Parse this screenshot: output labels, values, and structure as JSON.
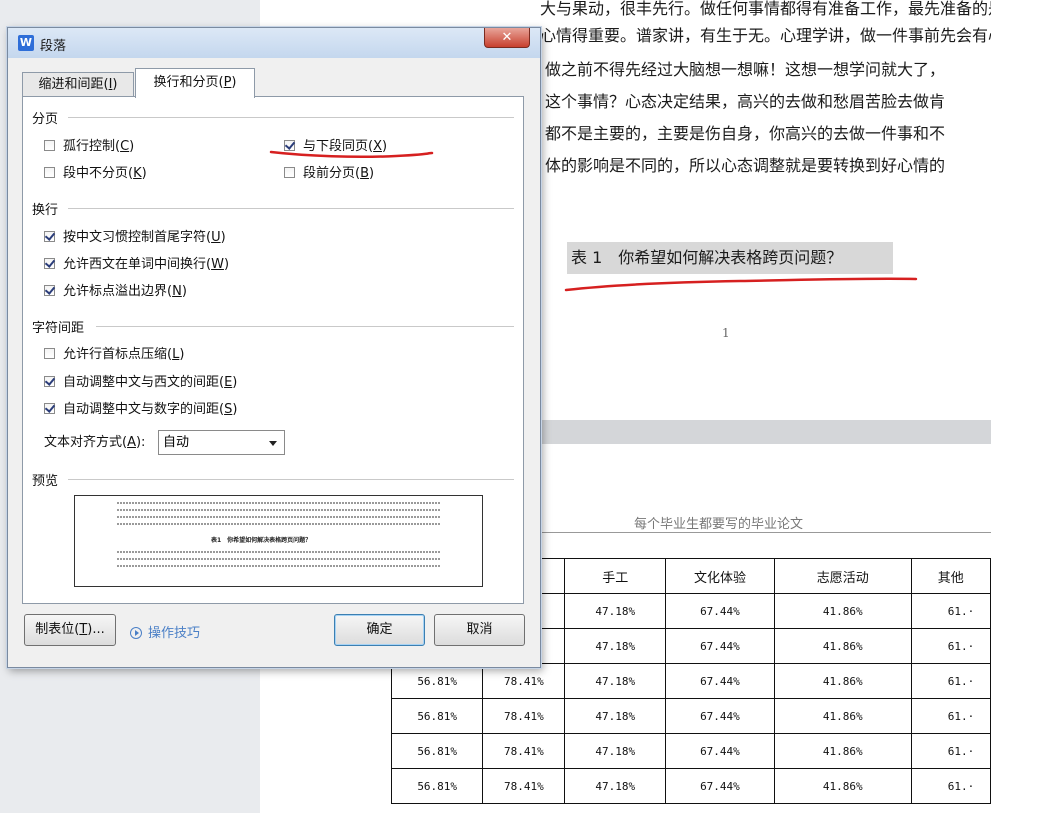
{
  "document": {
    "body_lines": [
      "大与果动，很丰先行。做任何事情都得有准备工作，最先准备的是情绪",
      "心情得重要。谱家讲，有生于无。心理学讲，做一件事前先会有心理活动",
      "做之前不得先经过大脑想一想嘛！这想一想学问就大了，",
      "这个事情？心态决定结果，高兴的去做和愁眉苦脸去做肯",
      "都不是主要的，主要是伤自身，你高兴的去做一件事和不",
      "体的影响是不同的，所以心态调整就是要转换到好心情的"
    ],
    "caption": "表 1　你希望如何解决表格跨页问题？",
    "page_number": "1",
    "page_header": "每个毕业生都要写的毕业论文",
    "table": {
      "header": [
        "",
        "",
        "手工",
        "文化体验",
        "志愿活动",
        "其他"
      ],
      "rows": [
        [
          "",
          "",
          "47.18%",
          "67.44%",
          "41.86%",
          "61.·"
        ],
        [
          "",
          "",
          "47.18%",
          "67.44%",
          "41.86%",
          "61.·"
        ],
        [
          "56.81%",
          "78.41%",
          "47.18%",
          "67.44%",
          "41.86%",
          "61.·"
        ],
        [
          "56.81%",
          "78.41%",
          "47.18%",
          "67.44%",
          "41.86%",
          "61.·"
        ],
        [
          "56.81%",
          "78.41%",
          "47.18%",
          "67.44%",
          "41.86%",
          "61.·"
        ],
        [
          "56.81%",
          "78.41%",
          "47.18%",
          "67.44%",
          "41.86%",
          "61.·"
        ]
      ],
      "partial_cells": [
        "%",
        "%"
      ]
    }
  },
  "dialog": {
    "title": "段落",
    "app_icon_letter": "W",
    "close_symbol": "✕",
    "tabs": [
      {
        "label": "缩进和间距(",
        "key": "I",
        "suffix": ")"
      },
      {
        "label": "换行和分页(",
        "key": "P",
        "suffix": ")"
      }
    ],
    "groups": {
      "pagination": "分页",
      "line_break": "换行",
      "char_spacing": "字符间距",
      "preview": "预览"
    },
    "options": {
      "widow_control": {
        "label": "孤行控制(",
        "key": "C",
        "suffix": ")",
        "checked": false
      },
      "keep_with_next": {
        "label": "与下段同页(",
        "key": "X",
        "suffix": ")",
        "checked": true
      },
      "keep_lines_together": {
        "label": "段中不分页(",
        "key": "K",
        "suffix": ")",
        "checked": false
      },
      "page_break_before": {
        "label": "段前分页(",
        "key": "B",
        "suffix": ")",
        "checked": false
      },
      "chinese_rules": {
        "label": "按中文习惯控制首尾字符(",
        "key": "U",
        "suffix": ")",
        "checked": true
      },
      "word_wrap": {
        "label": "允许西文在单词中间换行(",
        "key": "W",
        "suffix": ")",
        "checked": true
      },
      "punct_overflow": {
        "label": "允许标点溢出边界(",
        "key": "N",
        "suffix": ")",
        "checked": true
      },
      "compress_punct": {
        "label": "允许行首标点压缩(",
        "key": "L",
        "suffix": ")",
        "checked": false
      },
      "auto_space_west": {
        "label": "自动调整中文与西文的间距(",
        "key": "E",
        "suffix": ")",
        "checked": true
      },
      "auto_space_num": {
        "label": "自动调整中文与数字的间距(",
        "key": "S",
        "suffix": ")",
        "checked": true
      }
    },
    "text_align": {
      "label": "文本对齐方式(",
      "key": "A",
      "suffix": "):",
      "value": "自动"
    },
    "preview_caption": "表1　你希望如何解决表格跨页问题？",
    "buttons": {
      "tabs": {
        "label": "制表位(",
        "key": "T",
        "suffix": ")..."
      },
      "tips": "操作技巧",
      "ok": "确定",
      "cancel": "取消"
    }
  },
  "annotations": {
    "underline_color": "#d62020"
  }
}
